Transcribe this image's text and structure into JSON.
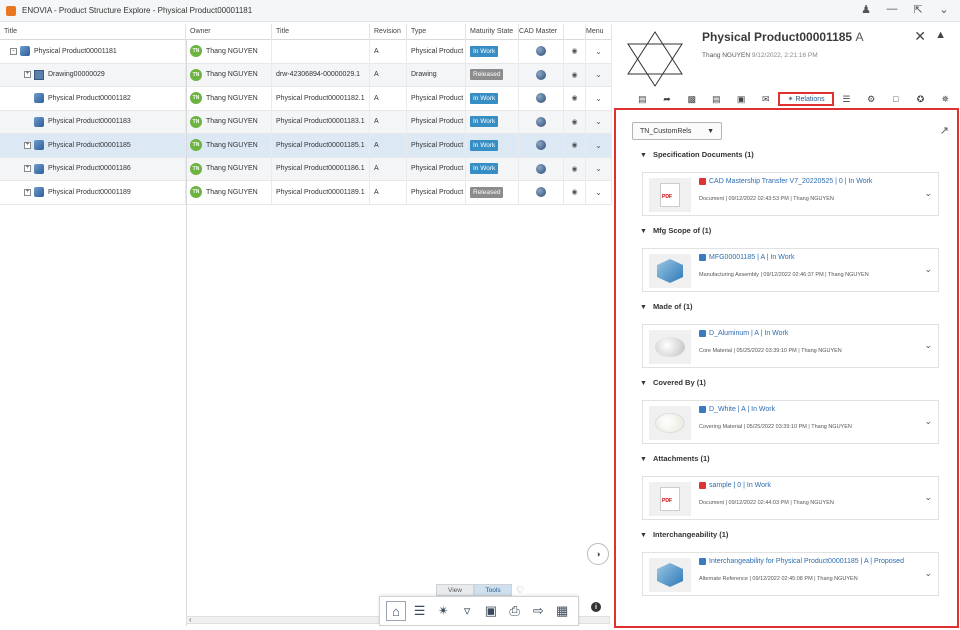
{
  "window": {
    "title": "ENOVIA - Product Structure Explore - Physical Product00001181"
  },
  "tree": {
    "columns": [
      "Title",
      "Owner",
      "Title",
      "Revision",
      "Type",
      "Maturity State",
      "CAD Master",
      "Menu"
    ],
    "rows": [
      {
        "title": "Physical Product00001181",
        "owner": "Thang NGUYEN",
        "initials": "TN",
        "ttl": "",
        "rev": "A",
        "type": "Physical Product",
        "state": "In Work",
        "expander": "-"
      },
      {
        "title": "Drawing00000029",
        "owner": "Thang NGUYEN",
        "initials": "TN",
        "ttl": "drw-42306894-00000029.1",
        "rev": "A",
        "type": "Drawing",
        "state": "Released",
        "expander": "+"
      },
      {
        "title": "Physical Product00001182",
        "owner": "Thang NGUYEN",
        "initials": "TN",
        "ttl": "Physical Product00001182.1",
        "rev": "A",
        "type": "Physical Product",
        "state": "In Work",
        "expander": ""
      },
      {
        "title": "Physical Product00001183",
        "owner": "Thang NGUYEN",
        "initials": "TN",
        "ttl": "Physical Product00001183.1",
        "rev": "A",
        "type": "Physical Product",
        "state": "In Work",
        "expander": ""
      },
      {
        "title": "Physical Product00001185",
        "owner": "Thang NGUYEN",
        "initials": "TN",
        "ttl": "Physical Product00001185.1",
        "rev": "A",
        "type": "Physical Product",
        "state": "In Work",
        "expander": "+"
      },
      {
        "title": "Physical Product00001186",
        "owner": "Thang NGUYEN",
        "initials": "TN",
        "ttl": "Physical Product00001186.1",
        "rev": "A",
        "type": "Physical Product",
        "state": "In Work",
        "expander": "+"
      },
      {
        "title": "Physical Product00001189",
        "owner": "Thang NGUYEN",
        "initials": "TN",
        "ttl": "Physical Product00001189.1",
        "rev": "A",
        "type": "Physical Product",
        "state": "Released",
        "expander": "+"
      }
    ]
  },
  "bottom": {
    "tab_view": "View",
    "tab_tools": "Tools"
  },
  "details": {
    "name": "Physical Product00001185",
    "revision": "A",
    "owner": "Thang NGUYEN",
    "date": "9/12/2022, 2:21:16 PM",
    "relations_label": "Relations",
    "dropdown_value": "TN_CustomRels",
    "sections": [
      {
        "header": "Specification Documents (1)",
        "link": "CAD Mastership Transfer V7_20220525 | 0 | In Work",
        "meta": "Document | 09/12/2022 02:43:53 PM | Thang NGUYEN",
        "thumb": "pdf"
      },
      {
        "header": "Mfg Scope of (1)",
        "link": "MFG00001185 | A | In Work",
        "meta": "Manufacturing Assembly | 09/12/2022 02:46:37 PM | Thang NGUYEN",
        "thumb": "cube"
      },
      {
        "header": "Made of (1)",
        "link": "D_Aluminum | A | In Work",
        "meta": "Core Material | 05/25/2022 03:39:10 PM | Thang NGUYEN",
        "thumb": "blob"
      },
      {
        "header": "Covered By (1)",
        "link": "D_White | A | In Work",
        "meta": "Covering Material | 05/25/2022 03:39:10 PM | Thang NGUYEN",
        "thumb": "blobw"
      },
      {
        "header": "Attachments (1)",
        "link": "sample | 0 | In Work",
        "meta": "Document | 09/12/2022 02:44:03 PM | Thang NGUYEN",
        "thumb": "pdf"
      },
      {
        "header": "Interchangeability (1)",
        "link": "Interchangeability for Physical Product00001185 | A | Proposed",
        "meta": "Alternate Reference | 09/12/2022 02:45:08 PM | Thang NGUYEN",
        "thumb": "cube"
      }
    ]
  },
  "colors": {
    "in_work": "#368ec4",
    "released": "#8c8c8c",
    "highlight": "#e03131",
    "link": "#2b6cb0"
  }
}
